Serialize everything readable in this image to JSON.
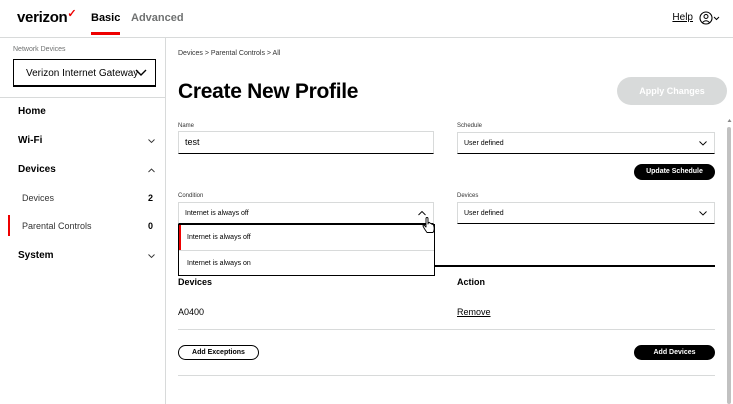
{
  "brand": {
    "name": "verizon",
    "mark": "✓",
    "accent": "#ee0000"
  },
  "topnav": {
    "tabs": [
      {
        "label": "Basic",
        "active": true
      },
      {
        "label": "Advanced",
        "active": false
      }
    ],
    "help": "Help"
  },
  "sidebar": {
    "network_label": "Network Devices",
    "device_select": "Verizon Internet Gateway",
    "items": [
      {
        "label": "Home"
      },
      {
        "label": "Wi-Fi",
        "icon": "chevron-down-icon"
      },
      {
        "label": "Devices",
        "icon": "chevron-up-icon"
      },
      {
        "label": "Devices",
        "count": "2"
      },
      {
        "label": "Parental Controls",
        "count": "0",
        "active": true
      },
      {
        "label": "System",
        "icon": "chevron-down-icon"
      }
    ]
  },
  "main": {
    "breadcrumb": "Devices  >  Parental Controls  >  All",
    "title": "Create New Profile",
    "apply_button": "Apply Changes",
    "name": {
      "label": "Name",
      "value": "test"
    },
    "schedule": {
      "label": "Schedule",
      "value": "User defined",
      "update_button": "Update Schedule"
    },
    "condition": {
      "label": "Condition",
      "value": "Internet is always off",
      "options": [
        "Internet is always off",
        "Internet is always on"
      ]
    },
    "devices_select": {
      "label": "Devices",
      "value": "User defined"
    },
    "table": {
      "headers": [
        "Devices",
        "Action"
      ],
      "rows": [
        {
          "device": "A0400",
          "action": "Remove"
        }
      ]
    },
    "add_exceptions_button": "Add Exceptions",
    "add_devices_button": "Add Devices"
  }
}
